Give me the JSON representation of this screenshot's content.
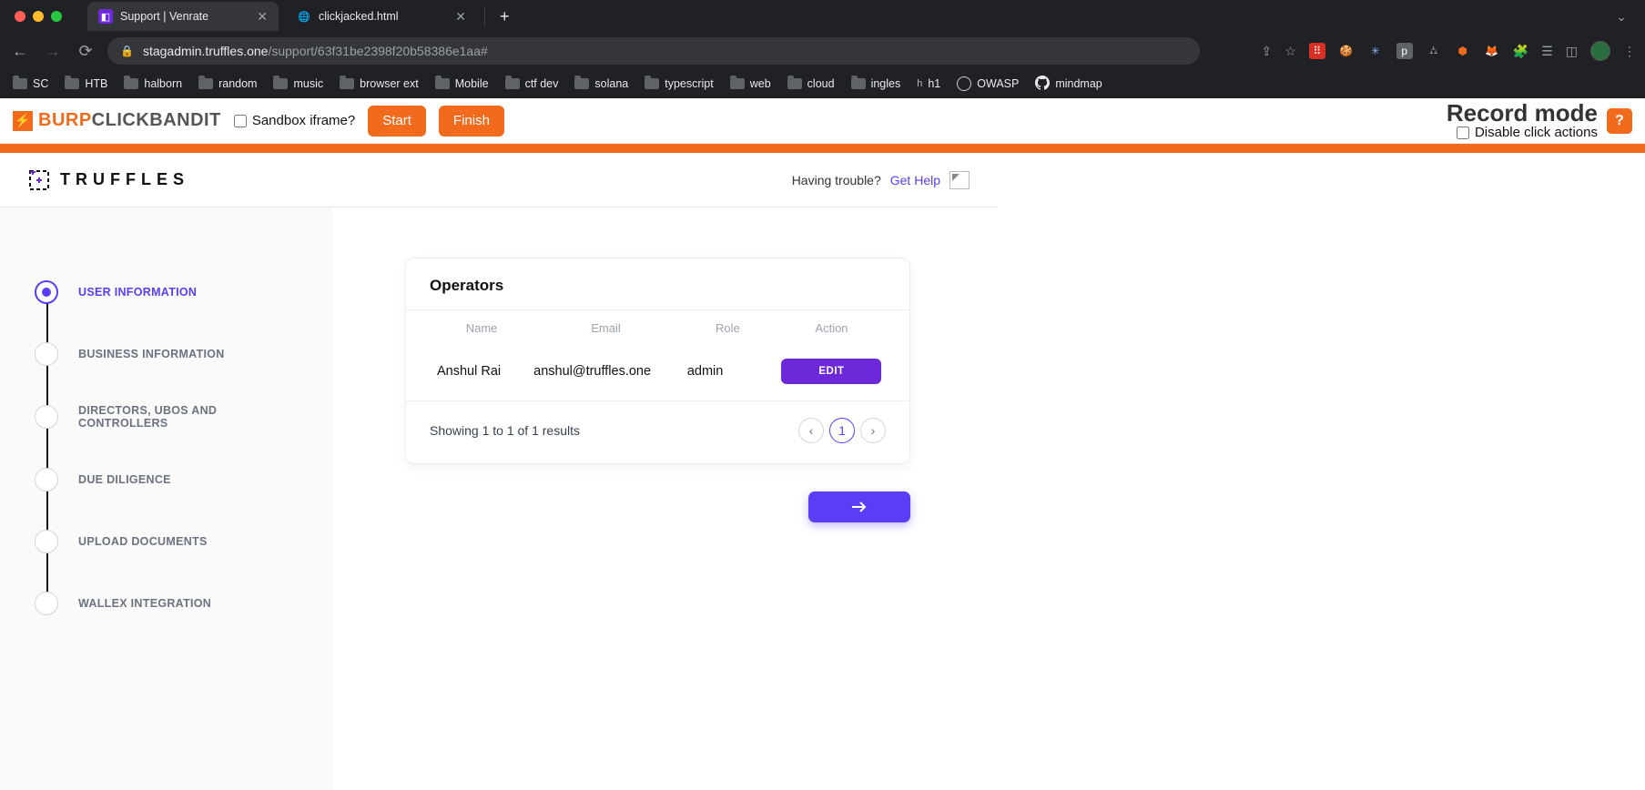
{
  "browser": {
    "tabs": [
      {
        "title": "Support | Venrate",
        "active": true
      },
      {
        "title": "clickjacked.html",
        "active": false
      }
    ],
    "url_host": "stagadmin.truffles.one",
    "url_path": "/support/63f31be2398f20b58386e1aa#",
    "bookmarks": [
      "SC",
      "HTB",
      "halborn",
      "random",
      "music",
      "browser ext",
      "Mobile",
      "ctf dev",
      "solana",
      "typescript",
      "web",
      "cloud",
      "ingles",
      "h1",
      "OWASP",
      "mindmap"
    ]
  },
  "burp": {
    "brand_a": "BURP",
    "brand_b": "CLICKBANDIT",
    "sandbox_label": "Sandbox iframe?",
    "start_label": "Start",
    "finish_label": "Finish",
    "record_label": "Record mode",
    "disable_label": "Disable click actions",
    "help_label": "?"
  },
  "app": {
    "brand": "TRUFFLES",
    "trouble_text": "Having trouble?",
    "gethelp_text": "Get Help"
  },
  "steps": {
    "s0": "USER INFORMATION",
    "s1": "BUSINESS INFORMATION",
    "s2": "DIRECTORS, UBOS AND CONTROLLERS",
    "s3": "DUE DILIGENCE",
    "s4": "UPLOAD DOCUMENTS",
    "s5": "WALLEX INTEGRATION"
  },
  "operators": {
    "title": "Operators",
    "cols": {
      "name": "Name",
      "email": "Email",
      "role": "Role",
      "action": "Action"
    },
    "row": {
      "name": "Anshul Rai",
      "email": "anshul@truffles.one",
      "role": "admin",
      "edit": "EDIT"
    },
    "results_text": "Showing 1 to 1 of 1 results",
    "page_current": "1"
  }
}
